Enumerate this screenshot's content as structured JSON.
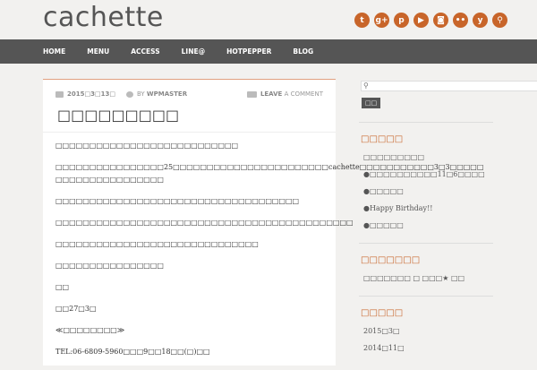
{
  "site": {
    "title": "cachette"
  },
  "social_icons": [
    "twitter-icon",
    "google-plus-icon",
    "pinterest-icon",
    "youtube-icon",
    "instagram-icon",
    "flickr-icon",
    "yelp-icon",
    "search-icon"
  ],
  "nav": [
    "HOME",
    "MENU",
    "ACCESS",
    "LINE@",
    "HOTPEPPER",
    "BLOG"
  ],
  "post": {
    "date": "2015□3□13□",
    "by": "BY",
    "author": "WPMASTER",
    "leave": "LEAVE",
    "comment": "A COMMENT",
    "title": "□□□□□□□□□",
    "paragraphs": [
      "□□□□□□□□□□□□□□□□□□□□□□□□□□□",
      "□□□□□□□□□□□□□□□□25□□□□□□□□□□□□□□□□□□□□□□□cachette□□□□□□□□□□□3□3□□□□□",
      "□□□□□□□□□□□□□□□□",
      "□□□□□□□□□□□□□□□□□□□□□□□□□□□□□□□□□□□□",
      "□□□□□□□□□□□□□□□□□□□□□□□□□□□□□□□□□□□□□□□□□□□□",
      "□□□□□□□□□□□□□□□□□□□□□□□□□□□□□□",
      "□□□□□□□□□□□□□□□□",
      "□□",
      "□□27□3□",
      "≪□□□□□□□□≫",
      "TEL:06-6809-5960□□□9□□18□□(□)□□"
    ]
  },
  "sidebar": {
    "search_button": "□□",
    "widgets": [
      {
        "title": "□□□□□",
        "items": [
          "□□□□□□□□□",
          "●□□□□□□□□□□11□6□□□□",
          "●□□□□□",
          "●Happy Birthday!!",
          "●□□□□□"
        ]
      },
      {
        "title": "□□□□□□□",
        "items": [
          "□□□□□□□ □ □□□★ □□"
        ]
      },
      {
        "title": "□□□□□",
        "items": [
          "2015□3□",
          "2014□11□"
        ]
      }
    ]
  }
}
